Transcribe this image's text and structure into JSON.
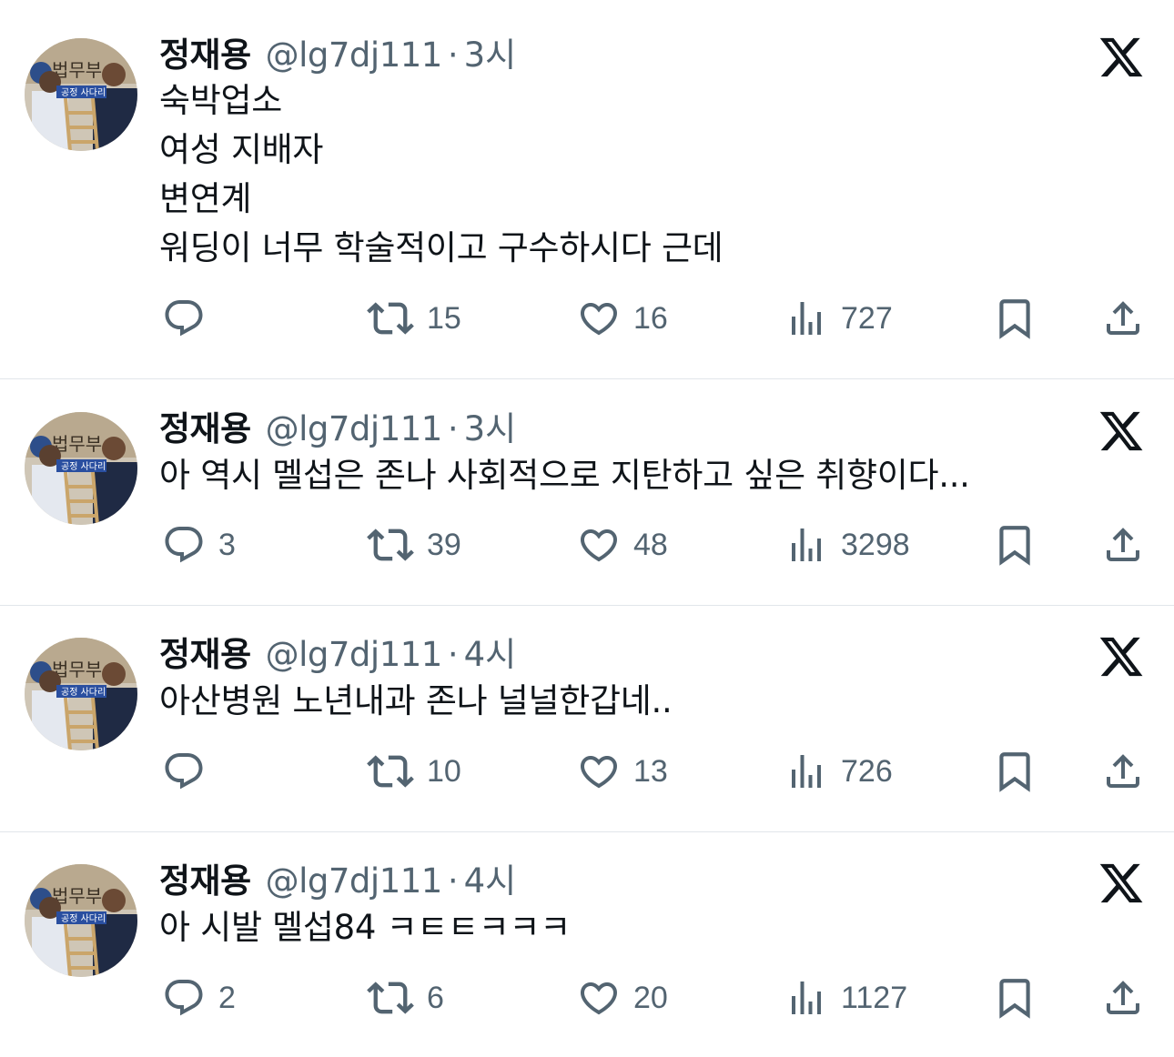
{
  "tweets": [
    {
      "name": "정재용",
      "handle": "@lg7dj111",
      "dot": "·",
      "time": "3시",
      "lines": [
        "숙박업소",
        "여성 지배자",
        "변연계",
        "워딩이 너무 학술적이고 구수하시다 근데"
      ],
      "replies": "",
      "retweets": "15",
      "likes": "16",
      "views": "727"
    },
    {
      "name": "정재용",
      "handle": "@lg7dj111",
      "dot": "·",
      "time": "3시",
      "lines": [
        "아 역시 멜섭은 존나 사회적으로 지탄하고 싶은 취향이다..."
      ],
      "replies": "3",
      "retweets": "39",
      "likes": "48",
      "views": "3298"
    },
    {
      "name": "정재용",
      "handle": "@lg7dj111",
      "dot": "·",
      "time": "4시",
      "lines": [
        "아산병원 노년내과 존나 널널한갑네.."
      ],
      "replies": "",
      "retweets": "10",
      "likes": "13",
      "views": "726"
    },
    {
      "name": "정재용",
      "handle": "@lg7dj111",
      "dot": "·",
      "time": "4시",
      "lines": [
        "아 시발 멜섭84 ㅋㅌㅌㅋㅋㅋ"
      ],
      "replies": "2",
      "retweets": "6",
      "likes": "20",
      "views": "1127"
    }
  ],
  "avatar_sign_text": "법무부",
  "avatar_banner_text": "공정 사다리",
  "icons": {
    "reply": "reply-icon",
    "retweet": "retweet-icon",
    "like": "heart-icon",
    "views": "views-icon",
    "bookmark": "bookmark-icon",
    "share": "share-icon",
    "logo": "x-logo-icon"
  },
  "colors": {
    "text": "#0f1419",
    "secondary": "#536471",
    "divider": "#e1e6ea"
  }
}
